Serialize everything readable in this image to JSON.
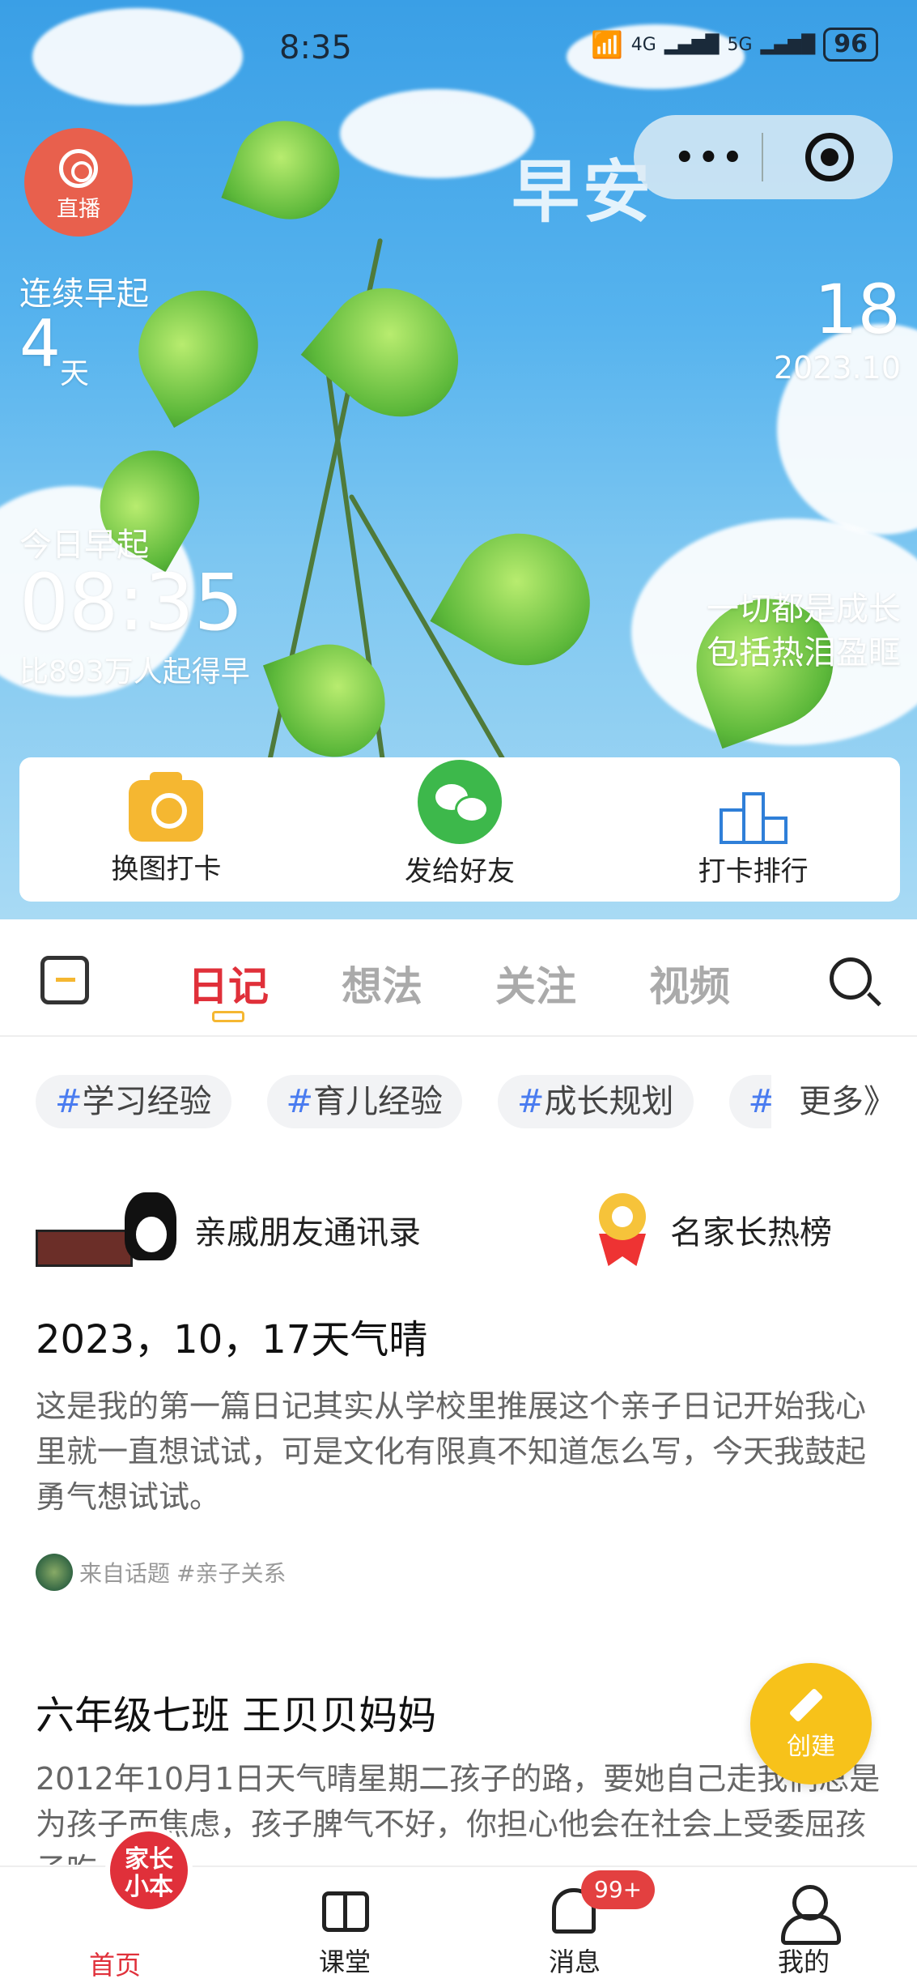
{
  "status": {
    "time": "8:35",
    "net1": "4G",
    "net2": "5G",
    "battery": "96"
  },
  "header": {
    "live_label": "直播",
    "greeting": "早安",
    "menu_dots": "•••"
  },
  "streak": {
    "label": "连续早起",
    "days": "4",
    "unit": "天"
  },
  "date": {
    "day": "18",
    "year_month": "2023.10"
  },
  "today": {
    "label": "今日早起",
    "time": "08:35",
    "rank": "比893万人起得早"
  },
  "quote": {
    "line1": "一切都是成长",
    "line2": "包括热泪盈眶"
  },
  "actions": [
    {
      "label": "换图打卡"
    },
    {
      "label": "发给好友"
    },
    {
      "label": "打卡排行"
    }
  ],
  "tabs": [
    {
      "label": "日记"
    },
    {
      "label": "想法"
    },
    {
      "label": "关注"
    },
    {
      "label": "视频"
    }
  ],
  "tags": [
    {
      "hash": "#",
      "text": "学习经验"
    },
    {
      "hash": "#",
      "text": "育儿经验"
    },
    {
      "hash": "#",
      "text": "成长规划"
    },
    {
      "hash": "#",
      "text": ""
    }
  ],
  "more_label": "更多》",
  "features": [
    {
      "label": "亲戚朋友通讯录"
    },
    {
      "label": "名家长热榜"
    }
  ],
  "posts": [
    {
      "title": "2023，10，17天气晴",
      "body": "这是我的第一篇日记其实从学校里推展这个亲子日记开始我心里就一直想试试，可是文化有限真不知道怎么写，今天我鼓起勇气想试试。",
      "source_prefix": "来自话题",
      "source_topic": "#亲子关系"
    },
    {
      "title": "六年级七班 王贝贝妈妈",
      "body": "2012年10月1日天气晴星期二孩子的路，要她自己走我们总是为孩子而焦虑，孩子脾气不好，你担心他会在社会上受委屈孩子吃"
    }
  ],
  "fab_label": "创建",
  "bottom_nav": {
    "home_logo_line1": "家长",
    "home_logo_line2": "小本",
    "items": [
      {
        "label": "首页"
      },
      {
        "label": "课堂"
      },
      {
        "label": "消息"
      },
      {
        "label": "我的"
      }
    ],
    "message_badge": "99+"
  },
  "colors": {
    "accent": "#e0303a",
    "tag_hash": "#4a7cf0",
    "fab": "#f7c21a"
  }
}
